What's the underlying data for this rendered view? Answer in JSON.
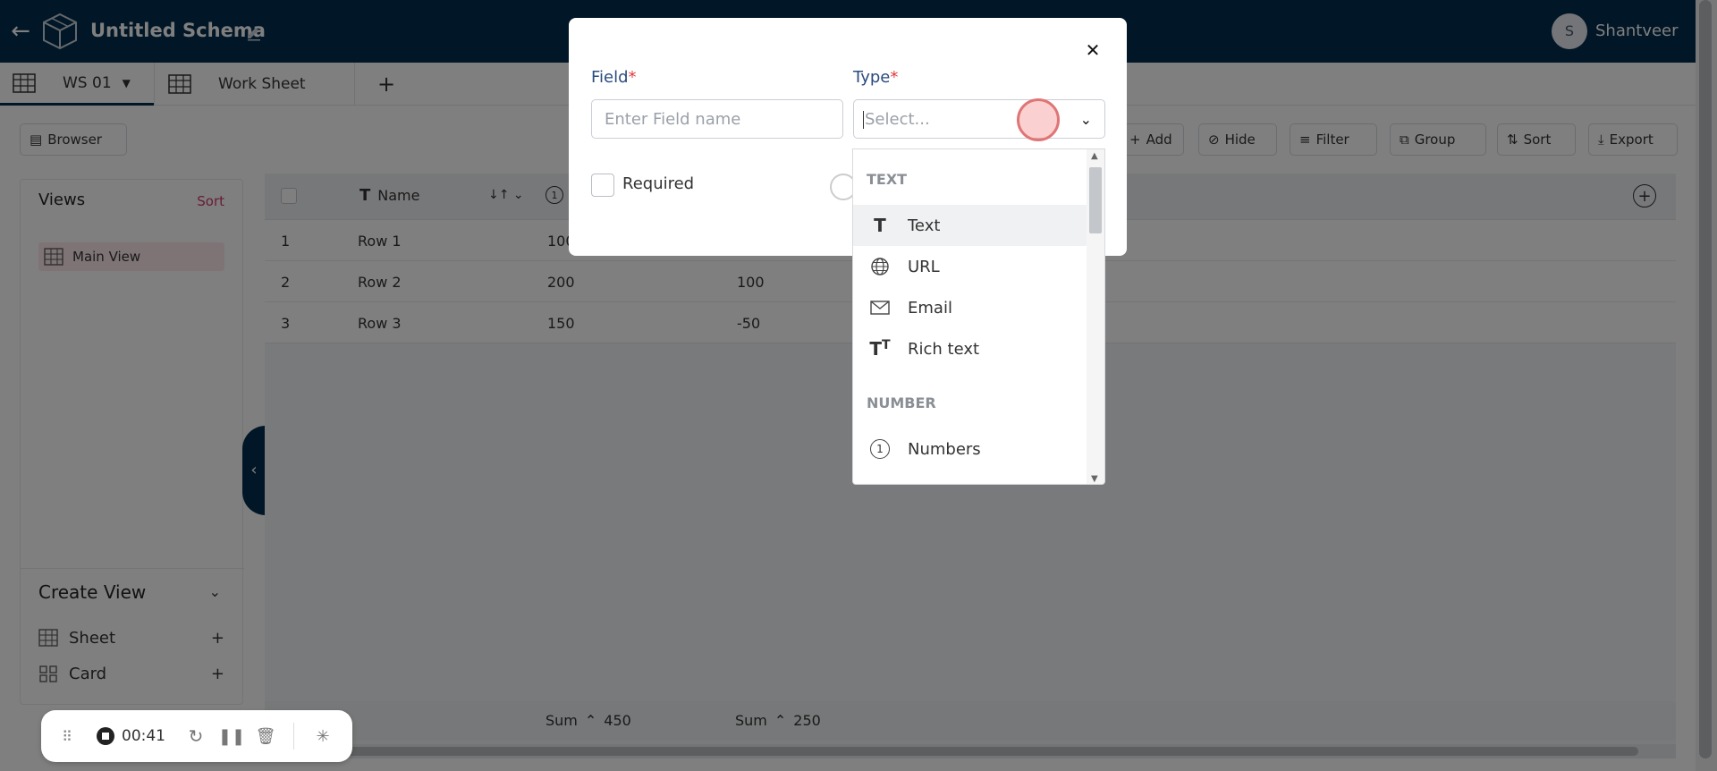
{
  "topbar": {
    "back_icon": "arrow-left-icon",
    "title": "Untitled Schema",
    "avatar_initial": "S",
    "user_name": "Shantveer"
  },
  "tabs": [
    {
      "label": "WS 01",
      "active": true
    },
    {
      "label": "Work Sheet",
      "active": false
    }
  ],
  "toolbar": {
    "browser": "Browser",
    "add": "Add",
    "hide": "Hide",
    "filter": "Filter",
    "group": "Group",
    "sort": "Sort",
    "export": "Export"
  },
  "sidebar": {
    "title": "Views",
    "sort": "Sort",
    "main_view": "Main View",
    "create_title": "Create View",
    "create_items": [
      {
        "label": "Sheet"
      },
      {
        "label": "Card"
      }
    ]
  },
  "grid": {
    "header_name": "Name",
    "rows": [
      {
        "num": "1",
        "name": "Row 1",
        "c1": "100",
        "c2": ""
      },
      {
        "num": "2",
        "name": "Row 2",
        "c1": "200",
        "c2": "100"
      },
      {
        "num": "3",
        "name": "Row 3",
        "c1": "150",
        "c2": "-50"
      }
    ],
    "footer": [
      {
        "label": "Sum",
        "value": "450"
      },
      {
        "label": "Sum",
        "value": "250"
      }
    ]
  },
  "modal": {
    "field_label": "Field",
    "type_label": "Type",
    "required_mark": "*",
    "field_placeholder": "Enter Field name",
    "type_placeholder": "Select...",
    "required_label": "Required"
  },
  "dropdown": {
    "group_text": "TEXT",
    "group_number": "NUMBER",
    "items": [
      {
        "label": "Text",
        "icon": "text-type-icon"
      },
      {
        "label": "URL",
        "icon": "globe-icon"
      },
      {
        "label": "Email",
        "icon": "mail-icon"
      },
      {
        "label": "Rich text",
        "icon": "rich-text-icon"
      },
      {
        "label": "Numbers",
        "icon": "number-circle-icon"
      }
    ]
  },
  "recorder": {
    "time": "00:41"
  }
}
